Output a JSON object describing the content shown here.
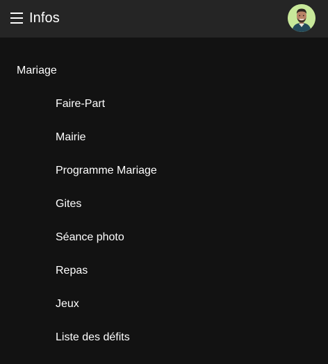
{
  "app_bar": {
    "title": "Infos",
    "menu_icon": "hamburger-menu-icon",
    "avatar_icon": "user-avatar"
  },
  "section": {
    "title": "Mariage",
    "items": [
      {
        "label": "Faire-Part"
      },
      {
        "label": "Mairie"
      },
      {
        "label": "Programme Mariage"
      },
      {
        "label": "Gites"
      },
      {
        "label": "Séance photo"
      },
      {
        "label": "Repas"
      },
      {
        "label": "Jeux"
      },
      {
        "label": "Liste des défits"
      }
    ]
  },
  "colors": {
    "background": "#121212",
    "app_bar": "#252525",
    "text": "#ffffff",
    "avatar_bg": "#c8e89a"
  }
}
